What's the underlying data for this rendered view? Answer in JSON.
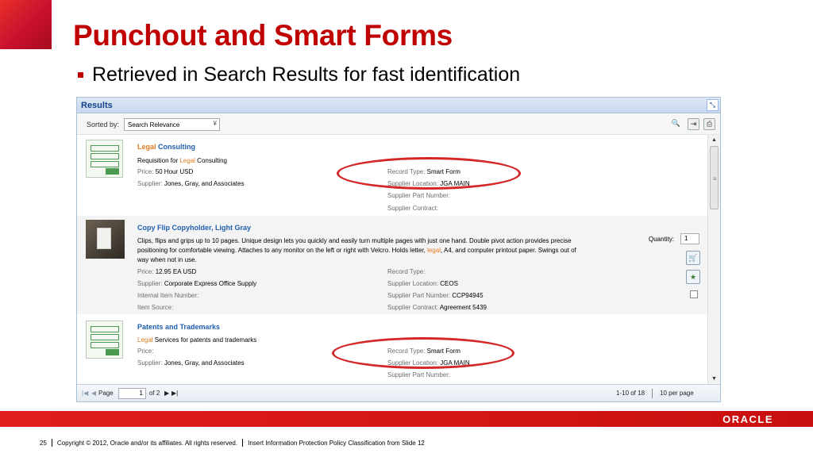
{
  "slide": {
    "title": "Punchout and Smart Forms",
    "bullet": "Retrieved in Search Results for fast identification"
  },
  "panel": {
    "title": "Results",
    "sort_label": "Sorted by:",
    "sort_value": "Search Relevance"
  },
  "results": [
    {
      "title_highlight": "Legal",
      "title_rest": " Consulting",
      "desc_prefix": "Requisition for ",
      "desc_highlight": "Legal",
      "desc_suffix": " Consulting",
      "price_label": "Price:",
      "price_value": "50 Hour USD",
      "supplier_label": "Supplier:",
      "supplier_value": "Jones, Gray, and Associates",
      "record_type_label": "Record Type:",
      "record_type_value": "Smart Form",
      "location_label": "Supplier Location:",
      "location_value": "JGA MAIN",
      "part_label": "Supplier Part Number:",
      "contract_label": "Supplier Contract:"
    },
    {
      "title": "Copy Flip Copyholder, Light Gray",
      "desc_line1": "Clips, flips and grips up to 10 pages. Unique design lets you quickly and easily turn multiple pages with just one hand. Double pivot action provides precise",
      "desc_line2_prefix": "positioning for comfortable viewing. Attaches to any monitor on the left or right with Velcro. Holds letter, ",
      "desc_line2_highlight": "legal",
      "desc_line2_suffix": ", A4, and computer printout paper. Swings out of",
      "desc_line3": "way when not in use.",
      "price_label": "Price:",
      "price_value": "12.95 EA USD",
      "supplier_label": "Supplier:",
      "supplier_value": "Corporate Express Office Supply",
      "internal_label": "Internal Item Number:",
      "source_label": "Item Source:",
      "record_type_label": "Record Type:",
      "location_label": "Supplier Location:",
      "location_value": "CEOS",
      "part_label": "Supplier Part Number:",
      "part_value": "CCP94945",
      "contract_label": "Supplier Contract:",
      "contract_value": "Agreement 5439",
      "quantity_label": "Quantity:",
      "quantity_value": "1"
    },
    {
      "title": "Patents and Trademarks",
      "desc_highlight": "Legal",
      "desc_suffix": " Services for patents and trademarks",
      "price_label": "Price:",
      "supplier_label": "Supplier:",
      "supplier_value": "Jones, Gray, and Associates",
      "record_type_label": "Record Type:",
      "record_type_value": "Smart Form",
      "location_label": "Supplier Location:",
      "location_value": "JGA MAIN",
      "part_label": "Supplier Part Number:"
    }
  ],
  "pager": {
    "page_label": "Page",
    "page_value": "1",
    "of_label": "of 2",
    "range": "1-10 of 18",
    "per_page": "10 per page"
  },
  "icons": {
    "corner": "corner-block",
    "search": "magnifier-icon",
    "export": "export-icon",
    "print": "printer-icon",
    "expand": "expand-icon",
    "thumbnail": "spreadsheet-icon",
    "add_to_cart": "add-to-cart-icon",
    "favorite": "favorite-icon"
  },
  "colors": {
    "accent_red": "#c00000",
    "link_blue": "#1f5fae",
    "highlight_orange": "#e27a1e",
    "annotation_red": "#d42727"
  },
  "footer": {
    "slide_number": "25",
    "copyright": "Copyright © 2012, Oracle and/or its affiliates. All rights reserved.",
    "classification": "Insert Information Protection Policy Classification from Slide 12",
    "logo": "ORACLE"
  }
}
